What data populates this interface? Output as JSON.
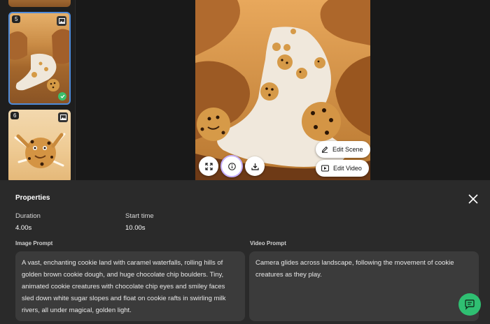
{
  "scenes": {
    "items": [
      {
        "number": "5"
      },
      {
        "number": "6"
      }
    ]
  },
  "preview": {
    "edit_scene_label": "Edit Scene",
    "edit_video_label": "Edit Video"
  },
  "properties": {
    "title": "Properties",
    "duration_label": "Duration",
    "duration_value": "4.00s",
    "start_time_label": "Start time",
    "start_time_value": "10.00s",
    "image_prompt_label": "Image Prompt",
    "image_prompt_text": "A vast, enchanting cookie land with caramel waterfalls, rolling hills of golden brown cookie dough, and huge chocolate chip boulders. Tiny, animated cookie creatures with chocolate chip eyes and smiley faces sled down white sugar slopes and float on cookie rafts in swirling milk rivers, all under magical, golden light.",
    "video_prompt_label": "Video Prompt",
    "video_prompt_text": "Camera glides across landscape, following the movement of cookie creatures as they play."
  },
  "colors": {
    "accent_selected": "#4f8bd9",
    "success": "#3bbf6b",
    "chat": "#2fbf72"
  }
}
